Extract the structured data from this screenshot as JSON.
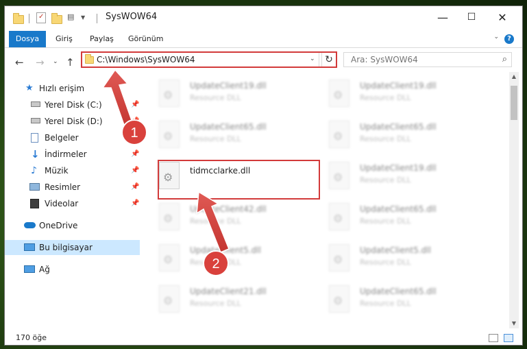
{
  "window": {
    "title": "SysWOW64",
    "controls": {
      "minimize": "—",
      "maximize": "☐",
      "close": "✕"
    }
  },
  "ribbon": {
    "tabs": [
      "Dosya",
      "Giriş",
      "Paylaş",
      "Görünüm"
    ],
    "help": "?"
  },
  "address": {
    "path": "C:\\Windows\\SysWOW64",
    "search_placeholder": "Ara: SysWOW64"
  },
  "sidebar": {
    "items": [
      {
        "label": "Hızlı erişim",
        "icon": "star-icon"
      },
      {
        "label": "Yerel Disk (C:)",
        "icon": "drive-icon",
        "pinned": true
      },
      {
        "label": "Yerel Disk (D:)",
        "icon": "drive-icon",
        "pinned": true
      },
      {
        "label": "Belgeler",
        "icon": "documents-icon",
        "pinned": true
      },
      {
        "label": "İndirmeler",
        "icon": "download-icon",
        "pinned": true
      },
      {
        "label": "Müzik",
        "icon": "music-icon",
        "pinned": true
      },
      {
        "label": "Resimler",
        "icon": "pictures-icon",
        "pinned": true
      },
      {
        "label": "Videolar",
        "icon": "video-icon",
        "pinned": true
      },
      {
        "label": "OneDrive",
        "icon": "cloud-icon"
      },
      {
        "label": "Bu bilgisayar",
        "icon": "computer-icon",
        "selected": true
      },
      {
        "label": "Ağ",
        "icon": "network-icon"
      }
    ]
  },
  "files": {
    "highlighted": {
      "name": "tidmcclarke.dll"
    },
    "items": [
      {
        "name": "UpdateClient19.dll",
        "desc": "Resource DLL"
      },
      {
        "name": "UpdateClient19.dll",
        "desc": "Resource DLL"
      },
      {
        "name": "UpdateClient65.dll",
        "desc": "Resource DLL"
      },
      {
        "name": "UpdateClient65.dll",
        "desc": "Resource DLL"
      },
      {
        "name": "UpdateClient19.dll",
        "desc": "Resource DLL"
      },
      {
        "name": "UpdateClient42.dll",
        "desc": "Resource DLL"
      },
      {
        "name": "UpdateClient65.dll",
        "desc": "Resource DLL"
      },
      {
        "name": "UpdateClient5.dll",
        "desc": "Resource DLL"
      },
      {
        "name": "UpdateClient5.dll",
        "desc": "Resource DLL"
      },
      {
        "name": "UpdateClient21.dll",
        "desc": "Resource DLL"
      },
      {
        "name": "UpdateClient65.dll",
        "desc": "Resource DLL"
      }
    ]
  },
  "status": {
    "count": "170 öğe"
  },
  "annotations": {
    "step1": "1",
    "step2": "2"
  },
  "colors": {
    "accent": "#1979ca",
    "highlight": "#d23a3a",
    "selected": "#cce8ff"
  }
}
